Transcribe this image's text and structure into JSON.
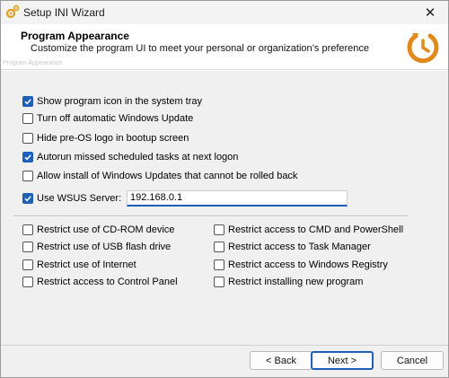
{
  "window": {
    "title": "Setup INI Wizard",
    "close_glyph": "✕"
  },
  "header": {
    "title": "Program Appearance",
    "subtitle": "Customize the program UI to meet your personal or organization’s preference",
    "ghost_text": "Program Appearance",
    "logo_icon": "power-clock-icon"
  },
  "options": [
    {
      "label": "Show program icon in the system tray",
      "checked": true
    },
    {
      "label": "Turn off automatic Windows Update",
      "checked": false
    },
    {
      "label": "Hide pre-OS logo in bootup screen",
      "checked": false
    },
    {
      "label": "Autorun missed scheduled tasks at next logon",
      "checked": true
    },
    {
      "label": "Allow install of Windows Updates that cannot be rolled back",
      "checked": false
    },
    {
      "label": "Use WSUS Server:",
      "checked": true
    }
  ],
  "wsus": {
    "value": "192.168.0.1"
  },
  "restrictions_left": [
    {
      "label": "Restrict use of CD-ROM device",
      "checked": false
    },
    {
      "label": "Restrict use of USB flash drive",
      "checked": false
    },
    {
      "label": "Restrict use of Internet",
      "checked": false
    },
    {
      "label": "Restrict access to Control Panel",
      "checked": false
    }
  ],
  "restrictions_right": [
    {
      "label": "Restrict access to CMD and PowerShell",
      "checked": false
    },
    {
      "label": "Restrict access to Task Manager",
      "checked": false
    },
    {
      "label": "Restrict access to Windows Registry",
      "checked": false
    },
    {
      "label": "Restrict installing new program",
      "checked": false
    }
  ],
  "buttons": {
    "back": "< Back",
    "next": "Next >",
    "cancel": "Cancel"
  },
  "colors": {
    "accent": "#1f5fb8",
    "logo_orange": "#e08a1e"
  }
}
